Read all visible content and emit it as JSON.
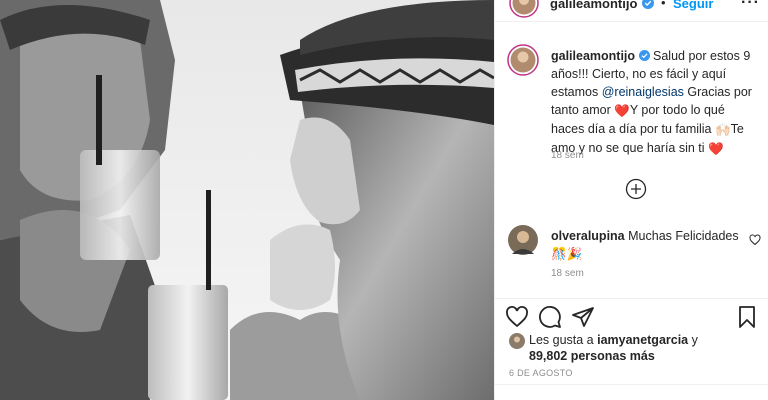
{
  "post": {
    "username": "galileamontijo",
    "follow_label": "Seguir",
    "separator": "•",
    "more_label": "···"
  },
  "caption": {
    "username": "galileamontijo",
    "text_part1": "Salud por estos 9 años!!! Cierto, no es fácil y aquí estamos ",
    "mention": "@reinaiglesias",
    "text_part2": " Gracias por tanto amor ",
    "text_part3": "Y por todo lo qué haces día a día por tu familia ",
    "text_part4": "Te amo y no se que haría sin ti ",
    "emoji_heart": "❤️",
    "emoji_hands": "🙌🏻",
    "time": "18 sem"
  },
  "comments": [
    {
      "username": "olveralupina",
      "text": "Muchas Felicidades",
      "emoji": "🎊🎉",
      "time": "18 sem"
    }
  ],
  "likes": {
    "prefix": "Les gusta a ",
    "user": "iamyanetgarcia",
    "conj": " y",
    "count": "89,802 personas más"
  },
  "date": "6 DE AGOSTO",
  "colors": {
    "link": "#0095f6",
    "mention": "#00376b",
    "meta": "#8e8e8e",
    "border": "#efefef",
    "heart": "#ed4956"
  },
  "icons": [
    "verified-badge-icon",
    "more-options-icon",
    "load-more-icon",
    "heart-icon",
    "comment-icon",
    "share-icon",
    "save-icon"
  ]
}
